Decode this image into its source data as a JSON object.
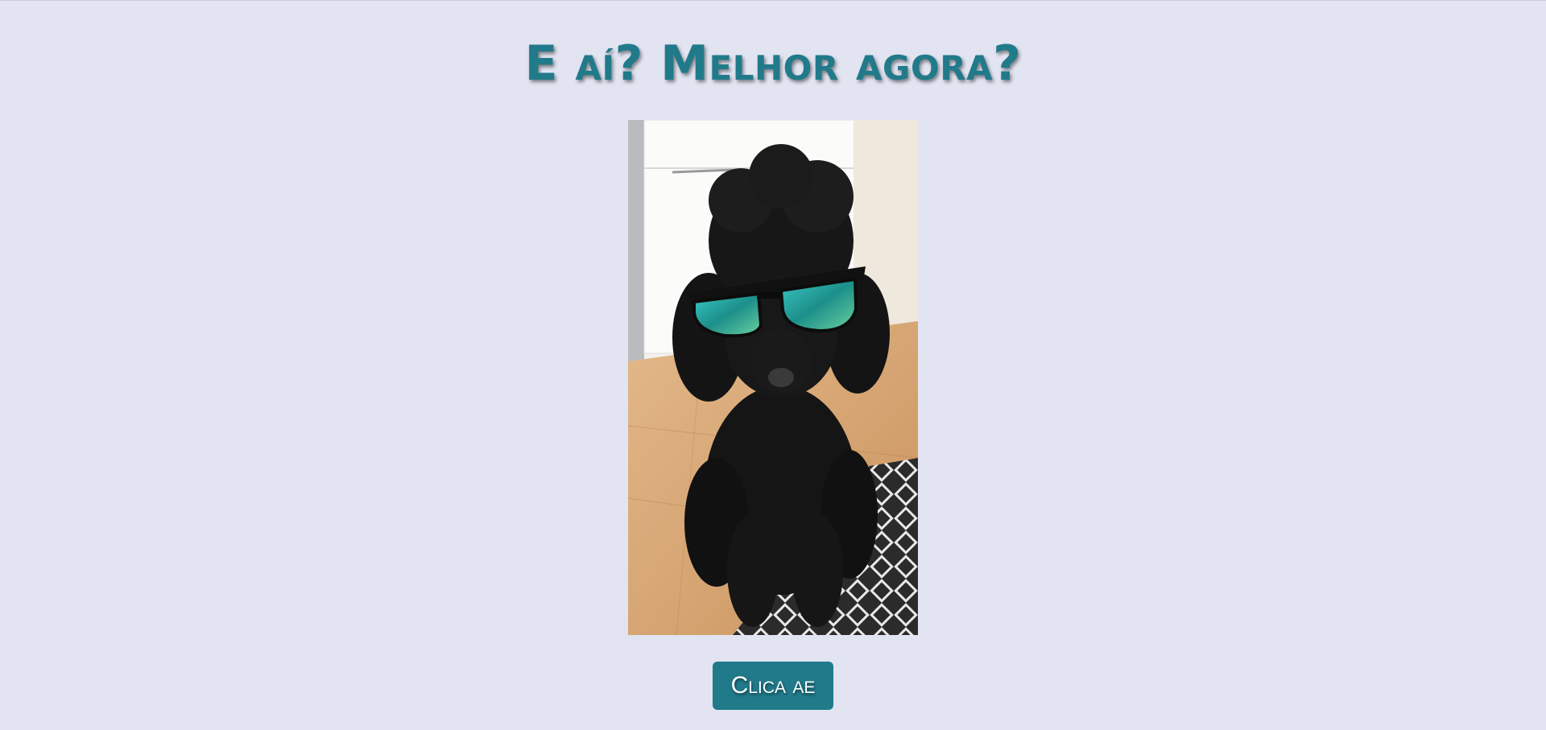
{
  "page": {
    "heading": "E aí? Melhor agora?",
    "image_subject": "black-poodle-with-sunglasses",
    "button_label": "Clica ae"
  },
  "colors": {
    "background": "#e2e4f2",
    "accent": "#217a8a",
    "button_text": "#ffffff"
  }
}
